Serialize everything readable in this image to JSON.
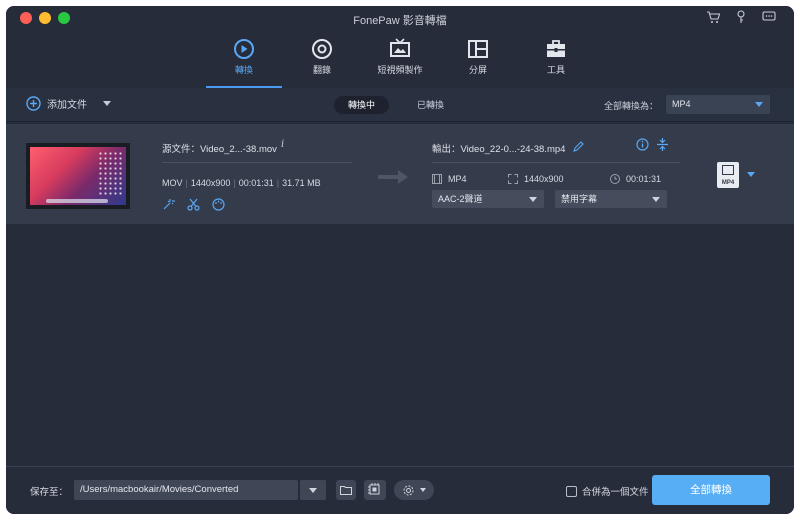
{
  "app": {
    "title": "FonePaw 影音轉檔"
  },
  "nav": {
    "items": [
      {
        "label": "轉換",
        "icon": "convert-icon",
        "active": true
      },
      {
        "label": "翻錄",
        "icon": "disc-icon",
        "active": false
      },
      {
        "label": "短視頻製作",
        "icon": "tv-icon",
        "active": false
      },
      {
        "label": "分屏",
        "icon": "split-screen-icon",
        "active": false
      },
      {
        "label": "工具",
        "icon": "toolbox-icon",
        "active": false
      }
    ]
  },
  "toolbar": {
    "add_file": "添加文件",
    "tab_converting": "轉換中",
    "tab_converted": "已轉換",
    "convert_all_to": "全部轉換為：",
    "format": "MP4"
  },
  "file": {
    "source_name": "源文件：Video_2...-38.mov",
    "format": "MOV",
    "resolution": "1440x900",
    "duration": "00:01:31",
    "size": "31.71 MB",
    "output_name": "輸出：Video_22-0...-24-38.mp4",
    "output_format": "MP4",
    "output_resolution": "1440x900",
    "output_duration": "00:01:31",
    "audio_track": "AAC-2聲道",
    "subtitle": "禁用字幕",
    "badge_text": "MP4"
  },
  "bottom": {
    "save_to": "保存至：",
    "path": "/Users/macbookair/Movies/Converted",
    "merge": "合併為一個文件",
    "convert_all": "全部轉換"
  },
  "colors": {
    "accent": "#58aef4",
    "background": "#262c3a",
    "row": "#343b4a"
  }
}
